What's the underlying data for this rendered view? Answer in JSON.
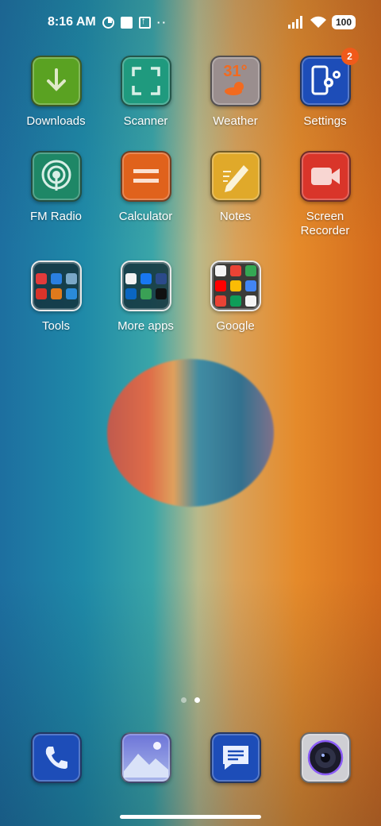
{
  "status_bar": {
    "time": "8:16 AM",
    "dots": "··",
    "battery": "100"
  },
  "apps": [
    {
      "label": "Downloads"
    },
    {
      "label": "Scanner"
    },
    {
      "label": "Weather",
      "temp": "31°"
    },
    {
      "label": "Settings",
      "badge": "2"
    },
    {
      "label": "FM Radio"
    },
    {
      "label": "Calculator"
    },
    {
      "label": "Notes"
    },
    {
      "label": "Screen Recorder"
    },
    {
      "label": "Tools"
    },
    {
      "label": "More apps"
    },
    {
      "label": "Google"
    }
  ],
  "page_indicator": {
    "pages": 2,
    "active_page": 2
  },
  "dock": [
    {
      "name": "phone"
    },
    {
      "name": "gallery"
    },
    {
      "name": "messages"
    },
    {
      "name": "camera"
    }
  ],
  "colors": {
    "downloads": "#5aa222",
    "scanner": "#1f9a7e",
    "weather": "#9a8e8e",
    "settings": "#1d4db8",
    "fm_radio": "#1e8766",
    "calculator": "#e0621c",
    "notes": "#e0a92a",
    "screen_recorder": "#d9352a",
    "badge": "#f05a1a"
  }
}
